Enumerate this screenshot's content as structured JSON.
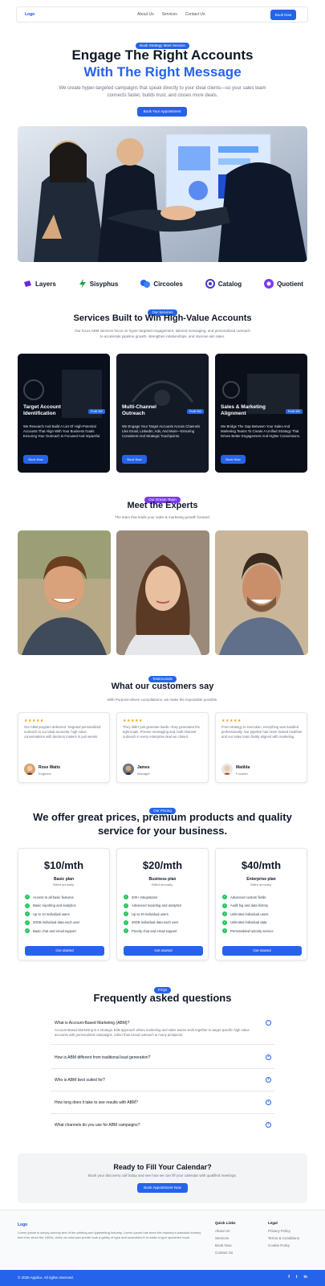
{
  "nav": {
    "logo": "Logo",
    "links": [
      "About Us",
      "Services",
      "Contact Us"
    ],
    "cta": "Book Now"
  },
  "hero": {
    "badge": "Book Strategy Meet Session",
    "title_line1": "Engage The Right Accounts",
    "title_line2": "With The Right Message",
    "subtitle": "We create hyper-targeted campaigns that speak directly to your ideal clients—so your sales team connects faster, builds trust, and closes more deals.",
    "cta": "Book Your Appointment"
  },
  "logos": [
    {
      "name": "Layers",
      "icon": "layers-icon",
      "color": "#6d28d9"
    },
    {
      "name": "Sisyphus",
      "icon": "bolt-icon",
      "color": "#16a34a"
    },
    {
      "name": "Circooles",
      "icon": "circles-icon",
      "color": "#2563eb"
    },
    {
      "name": "Catalog",
      "icon": "catalog-icon",
      "color": "#4338ca"
    },
    {
      "name": "Quotient",
      "icon": "quotient-icon",
      "color": "#7c3aed"
    }
  ],
  "services": {
    "badge": "Our Services",
    "title": "Services Built to Win High-Value Accounts",
    "subtitle": "Our focus ABM services focus on hyper-targeted engagement, tailored messaging, and personalized outreach to accelerate pipeline growth, strengthen relationships, and improve win rates.",
    "cards": [
      {
        "title": "Target Account Identification",
        "tag": "Profit 360",
        "desc": "We Research And Build A List Of High-Potential Accounts That Align With Your Business Goals Ensuring Your Outreach Is Focused And Impactful.",
        "button": "Book Now"
      },
      {
        "title": "Multi-Channel Outreach",
        "tag": "Profit 360",
        "desc": "We Engage Your Target Accounts Across Channels Like Email, LinkedIn, Ads, And More—Ensuring Consistent And Strategic Touchpoints.",
        "button": "Book Now"
      },
      {
        "title": "Sales & Marketing Alignment",
        "tag": "Profit 360",
        "desc": "We Bridge The Gap Between Your Sales And Marketing Teams To Create A Unified Strategy That Drives Better Engagement And Higher Conversions.",
        "button": "Book Now"
      }
    ]
  },
  "experts": {
    "badge": "Our Dream Team",
    "title": "Meet the Experts",
    "subtitle": "The team that leads your sales & marketing growth forward."
  },
  "testimonials": {
    "badge": "Testimonials",
    "title": "What our customers say",
    "subtitle": "With Purpose-driven consultations, we make the impossible possible.",
    "items": [
      {
        "stars": "★★★★★",
        "quote": "Our ABM program delivered. Targeted personalized outreach to our ideal accounts, high-value conversations with decision makers in just weeks.",
        "name": "Rose Watts",
        "role": "Engineer"
      },
      {
        "stars": "★★★★★",
        "quote": "They didn't just generate leads—they generated the right leads. Precise messaging and multi-channel outreach in every enterprise deal we closed.",
        "name": "James",
        "role": "Manager"
      },
      {
        "stars": "★★★★★",
        "quote": "From strategy to execution, everything was handled professionally. Our pipeline has never looked healthier and our sales team finally aligned with marketing.",
        "name": "Matilda",
        "role": "Founder"
      }
    ]
  },
  "pricing": {
    "badge": "Our Pricing",
    "title": "We offer great prices, premium products and quality service for your business.",
    "plans": [
      {
        "price": "$10/mth",
        "name": "Basic plan",
        "desc": "Billed annually.",
        "features": [
          "Access to all basic features",
          "Basic reporting and analytics",
          "Up to 10 individual users",
          "20GB individual data each user",
          "Basic chat and email support"
        ],
        "button": "Get started"
      },
      {
        "price": "$20/mth",
        "name": "Business plan",
        "desc": "Billed annually.",
        "features": [
          "200+ integrations",
          "Advanced reporting and analytics",
          "Up to 20 individual users",
          "40GB individual data each user",
          "Priority chat and email support"
        ],
        "button": "Get started"
      },
      {
        "price": "$40/mth",
        "name": "Enterprise plan",
        "desc": "Billed annually.",
        "features": [
          "Advanced custom fields",
          "Audit log and data history",
          "Unlimited individual users",
          "Unlimited individual data",
          "Personalised+priority service"
        ],
        "button": "Get started"
      }
    ]
  },
  "faq": {
    "badge": "FAQs",
    "title": "Frequently asked questions",
    "items": [
      {
        "q": "What is Account-Based Marketing (ABM)?",
        "a": "Account-Based Marketing is a strategic B2B approach where marketing and sales teams work together to target specific high-value accounts with personalized campaigns, rather than broad outreach to many prospects."
      },
      {
        "q": "How is ABM different from traditional lead generation?",
        "a": ""
      },
      {
        "q": "Who is ABM best suited for?",
        "a": ""
      },
      {
        "q": "How long does it take to see results with ABM?",
        "a": ""
      },
      {
        "q": "What channels do you use for ABM campaigns?",
        "a": ""
      }
    ]
  },
  "cta": {
    "title": "Ready to Fill Your Calendar?",
    "subtitle": "Book your discovery call today and see how we can fill your calendar with qualified meetings.",
    "button": "Book Appointment Now"
  },
  "footer": {
    "logo": "Logo",
    "about": "Lorem ipsum is simply dummy text of the printing and typesetting industry. Lorem Ipsum has been the industry's standard dummy text ever since the 1500s, when an unknown printer took a galley of type and scrambled it to make a type specimen book.",
    "col1_title": "Quick Links",
    "col1": [
      "About Us",
      "Services",
      "Book Now",
      "Contact Us"
    ],
    "col2_title": "Legal",
    "col2": [
      "Privacy Policy",
      "Terms & Conditions",
      "Cookie Policy"
    ],
    "copyright": "© 2025 Applico. All rights reserved.",
    "social": [
      "f",
      "t",
      "in"
    ]
  },
  "colors": {
    "accent": "#2563eb",
    "dark": "#111827",
    "muted": "#6b7280"
  }
}
